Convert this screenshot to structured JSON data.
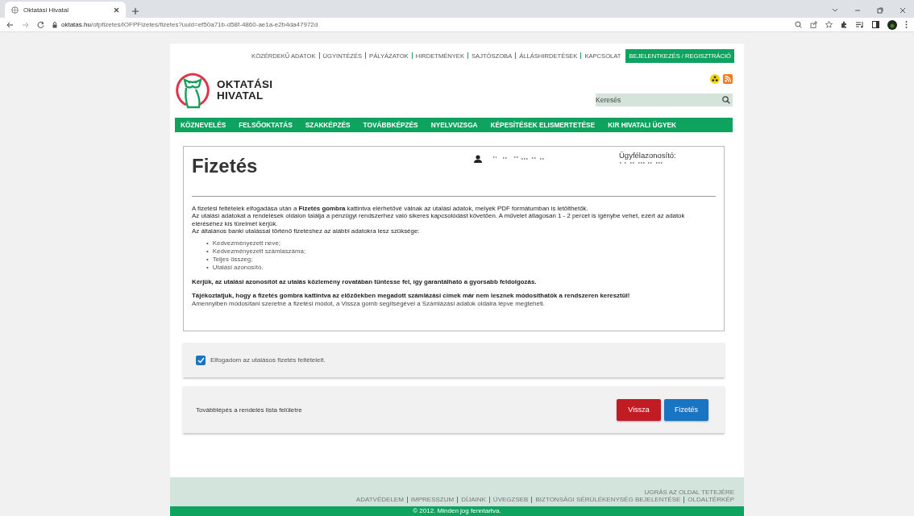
{
  "browser": {
    "tab_title": "Oktatási Hivatal",
    "url_host": "oktatas.hu",
    "url_path": "/ofpfizetes/IOFPFizetes/fizetes?uuid=ef50a71b-d58f-4860-ae1a-e2b4da47972d"
  },
  "top_links": [
    "KÖZÉRDEKŰ ADATOK",
    "ÜGYINTÉZÉS",
    "PÁLYÁZATOK",
    "HIRDETMÉNYEK",
    "SAJTÓSZOBA",
    "ÁLLÁSHIRDETÉSEK",
    "KAPCSOLAT"
  ],
  "login_link": "BEJELENTKEZÉS / REGISZTRÁCIÓ",
  "logo": {
    "line1": "OKTATÁSI",
    "line2": "HIVATAL"
  },
  "search": {
    "placeholder": "Keresés"
  },
  "nav": [
    "KÖZNEVELÉS",
    "FELSŐOKTATÁS",
    "SZAKKÉPZÉS",
    "TOVÁBBKÉPZÉS",
    "NYELVVIZSGA",
    "KÉPESÍTÉSEK ELISMERTETÉSE",
    "KIR HIVATALI ÜGYEK"
  ],
  "payment": {
    "title": "Fizetés",
    "client_id_label": "Ügyfélazonosító:",
    "intro": [
      "A fizetési feltételek elfogadása után a **Fizetés gombra** kattintva elérhetővé válnak az utalási adatok, melyek PDF formátumban is letölthetők.",
      "Az utalási adatokat a rendelések oldalon találja a pénzügyi rendszerhez való sikeres kapcsolódást követően. A művelet átlagosan 1 - 2 percet is igénybe vehet, ezért az adatok eléréséhez kis türelmét kérjük.",
      "Az általános banki utalással történő fizetéshez az alábbi adatokra lesz szüksége:"
    ],
    "bullet": "•",
    "list": [
      "Kedvezményezett neve;",
      "Kedvezményezett számlaszáma;",
      "Teljes összeg;",
      "Utalási azonosító."
    ],
    "notice": "Kérjük, az utalási azonosítót az utalás közlemény rovatában tüntesse fel, így garantálható a gyorsabb feldolgozás.",
    "warning": "Tájékoztatjuk, hogy a fizetés gombra kattintva az előzőekben megadott számlázási címek már nem lesznek módosíthatók a rendszeren keresztül!",
    "hint": "Amennyiben módosítani szeretné a fizetési módot, a Vissza gomb segítségével a Számlázási adatok oldalra lépve megteheti."
  },
  "accept": {
    "label": "Elfogadom az utalásos fizetés feltételeit.",
    "checked": true
  },
  "action": {
    "text": "Továbblépés a rendelés lista felületre",
    "buttons": [
      {
        "label": "Vissza",
        "kind": "back"
      },
      {
        "label": "Fizetés",
        "kind": "pay"
      }
    ]
  },
  "footer": {
    "top_link": "UGRÁS AZ OLDAL TETEJÉRE",
    "links": [
      "ADATVÉDELEM",
      "IMPRESSZUM",
      "DÍJAINK",
      "ÜVEGZSEB",
      "BIZTONSÁGI SÉRÜLÉKENYSÉG BEJELENTÉSE",
      "OLDALTÉRKÉP"
    ],
    "copyright": "© 2012. Minden jog fenntartva."
  }
}
